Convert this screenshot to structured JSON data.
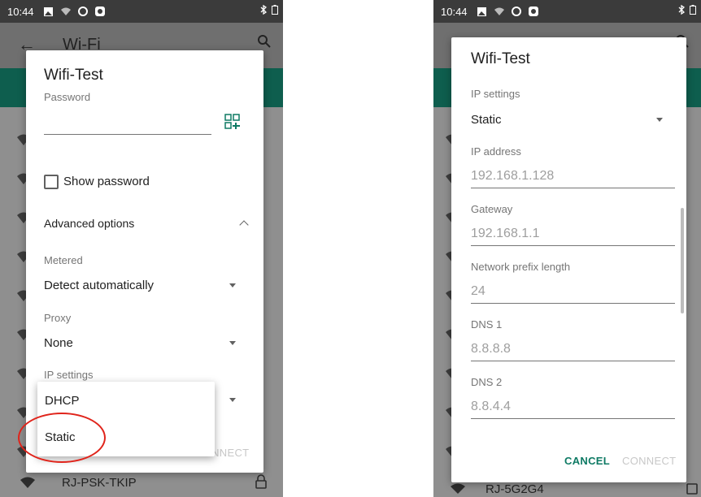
{
  "left": {
    "status_bar": {
      "time": "10:44"
    },
    "app_bar": {
      "title": "Wi-Fi"
    },
    "bottom_network": {
      "name": "RJ-PSK-TKIP"
    },
    "dialog": {
      "title": "Wifi-Test",
      "password_label": "Password",
      "show_password_label": "Show password",
      "advanced_options_label": "Advanced options",
      "metered_label": "Metered",
      "metered_value": "Detect automatically",
      "proxy_label": "Proxy",
      "proxy_value": "None",
      "ip_settings_label": "IP settings",
      "cancel_label": "CANCEL",
      "connect_label": "CONNECT"
    },
    "dropdown_options": [
      "DHCP",
      "Static"
    ]
  },
  "right": {
    "status_bar": {
      "time": "10:44"
    },
    "bottom_network": {
      "name": "RJ-5G2G4"
    },
    "dialog": {
      "title": "Wifi-Test",
      "ip_settings_label": "IP settings",
      "ip_settings_value": "Static",
      "ip_address_label": "IP address",
      "ip_address_value": "192.168.1.128",
      "gateway_label": "Gateway",
      "gateway_value": "192.168.1.1",
      "prefix_label": "Network prefix length",
      "prefix_value": "24",
      "dns1_label": "DNS 1",
      "dns1_value": "8.8.8.8",
      "dns2_label": "DNS 2",
      "dns2_value": "8.8.4.4",
      "cancel_label": "CANCEL",
      "connect_label": "CONNECT"
    }
  },
  "colors": {
    "accent": "#0e7a64",
    "highlight_circle": "#e0241b",
    "app_header": "#0e5e4e"
  },
  "icons": [
    "back-arrow-icon",
    "search-icon",
    "qr-code-scan-icon",
    "wifi-signal-icon",
    "lock-icon",
    "bluetooth-icon",
    "battery-icon"
  ]
}
